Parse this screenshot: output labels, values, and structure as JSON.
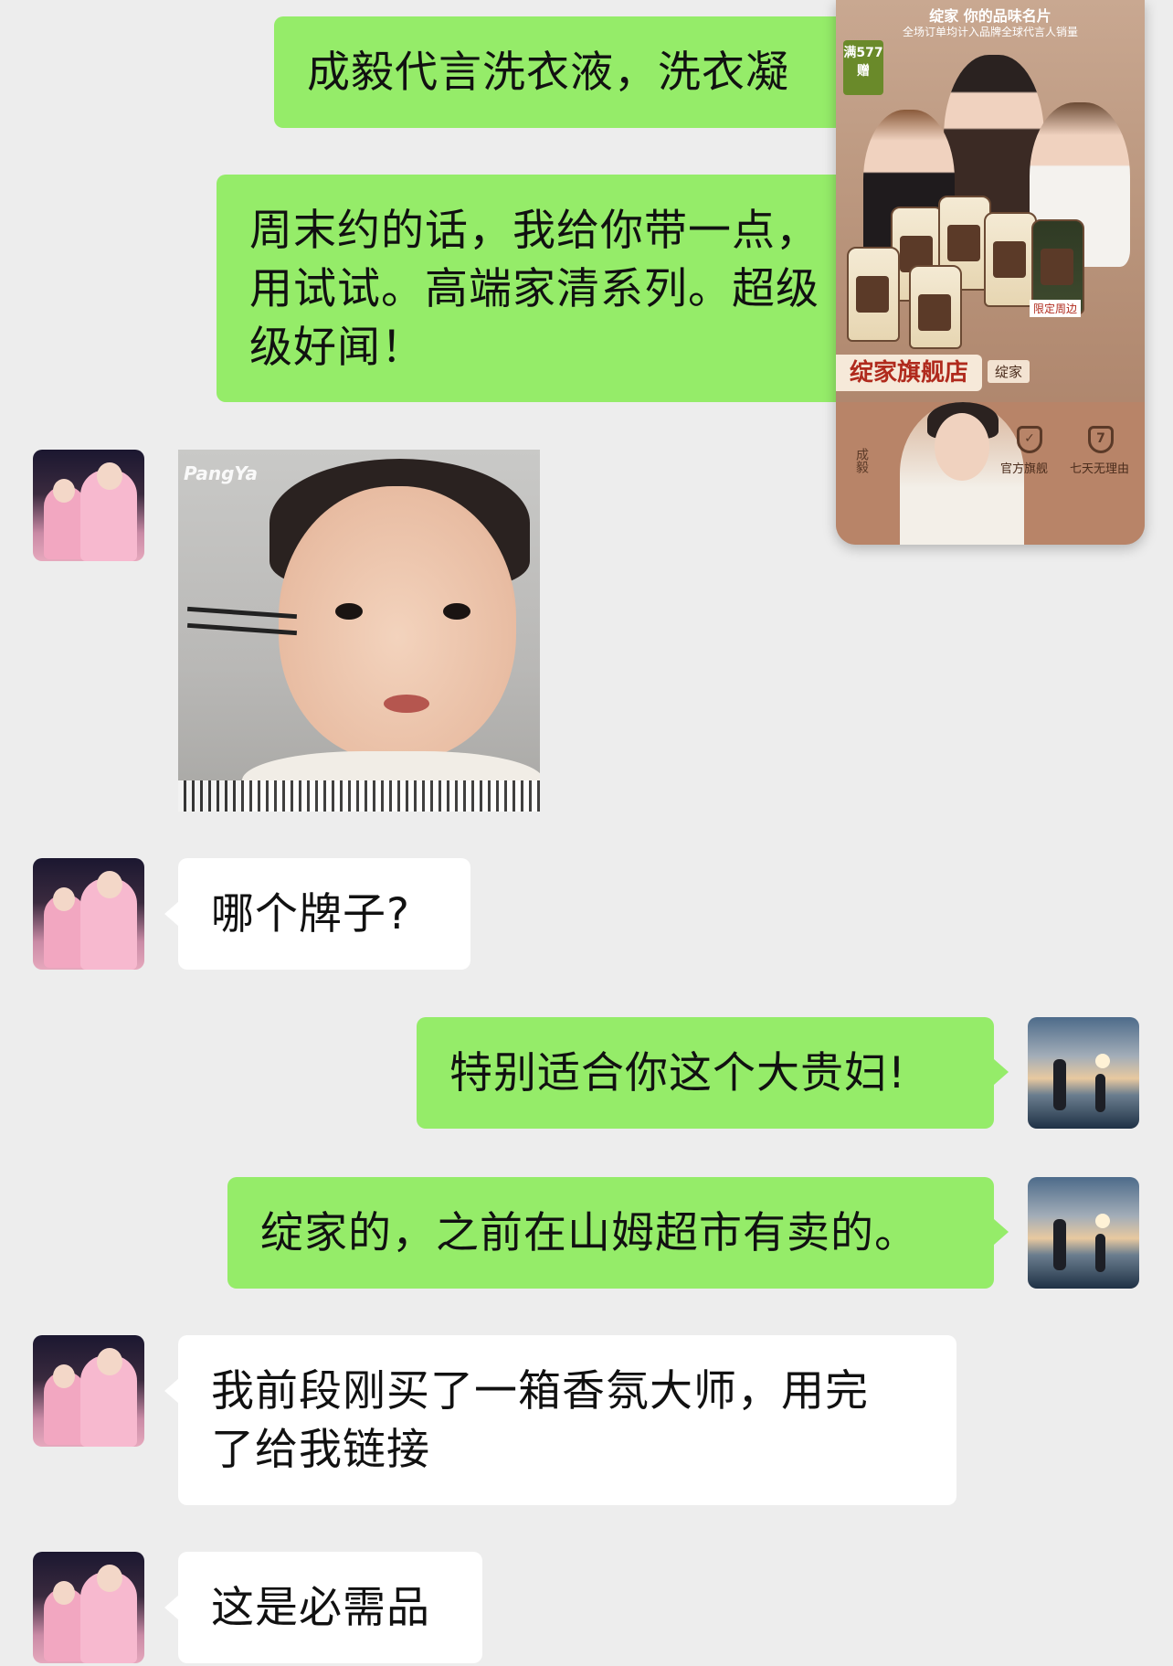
{
  "messages": [
    {
      "side": "me",
      "text": "成毅代言洗衣液，洗衣凝珠"
    },
    {
      "side": "me",
      "text": "周末约的话，我给你带一点，先用试试。高端家清系列。超级超级好闻！"
    },
    {
      "side": "other",
      "type": "sticker",
      "sticker_logo": "PangYa"
    },
    {
      "side": "other",
      "text": "哪个牌子?"
    },
    {
      "side": "me",
      "text": "特别适合你这个大贵妇!"
    },
    {
      "side": "me",
      "text": "绽家的，之前在山姆超市有卖的。"
    },
    {
      "side": "other",
      "text": "我前段刚买了一箱香氛大师，用完了给我链接"
    },
    {
      "side": "other",
      "text": "这是必需品"
    }
  ],
  "bubble_text": {
    "m0": "成毅代言洗衣液，洗衣凝",
    "m1": "周末约的话，我给你带一点，\n用试试。高端家清系列。超级\n级好闻！",
    "m3": "哪个牌子?",
    "m4": "特别适合你这个大贵妇!",
    "m5": "绽家的，之前在山姆超市有卖的。",
    "m6": "我前段刚买了一箱香氛大师，用完\n了给我链接",
    "m7": "这是必需品"
  },
  "ad_overlay": {
    "title": "绽家 你的品味名片",
    "subtitle": "全场订单均计入品牌全球代言人销量",
    "badge": "满577 赠",
    "limited_tag": "限定周边",
    "store_name": "绽家旗舰店",
    "store_brand": "绽家",
    "feature_1": "官方旗舰",
    "feature_2": "七天无理由",
    "shield_2_digit": "7",
    "signature": "成毅"
  },
  "colors": {
    "chat_background": "#ededed",
    "my_bubble": "#95ec69",
    "other_bubble": "#ffffff"
  }
}
